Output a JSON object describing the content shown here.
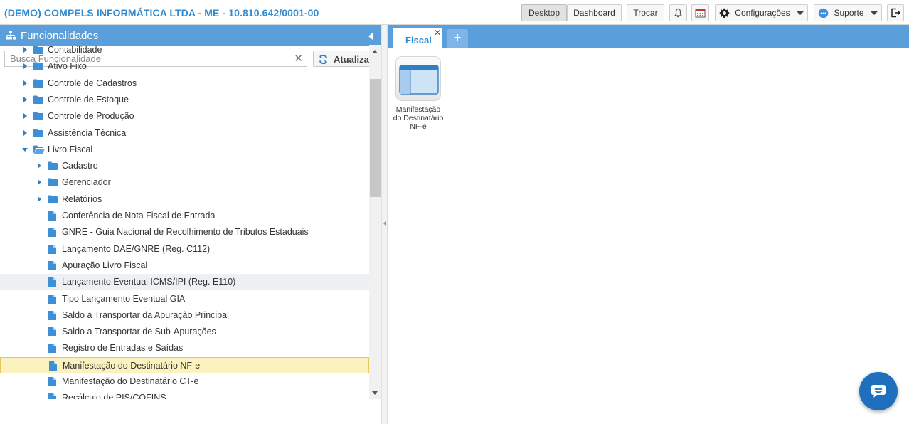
{
  "header": {
    "company": "(DEMO) COMPELS INFORMÁTICA LTDA - ME - 10.810.642/0001-00",
    "buttons": {
      "desktop": "Desktop",
      "dashboard": "Dashboard",
      "trocar": "Trocar",
      "configuracoes": "Configurações",
      "suporte": "Suporte"
    },
    "active_view": "Desktop",
    "icons": [
      "bell-icon",
      "calendar-icon",
      "gear-icon",
      "support-icon",
      "logout-icon"
    ]
  },
  "sidebar": {
    "title": "Funcionalidades",
    "search_placeholder": "Busca Funcionalidade",
    "search_value": "",
    "refresh_label": "Atualizar",
    "tree": [
      {
        "label": "Contabilidade",
        "type": "folder",
        "expanded": false,
        "level": 0
      },
      {
        "label": "Ativo Fixo",
        "type": "folder",
        "expanded": false,
        "level": 0
      },
      {
        "label": "Controle de Cadastros",
        "type": "folder",
        "expanded": false,
        "level": 0
      },
      {
        "label": "Controle de Estoque",
        "type": "folder",
        "expanded": false,
        "level": 0
      },
      {
        "label": "Controle de Produção",
        "type": "folder",
        "expanded": false,
        "level": 0
      },
      {
        "label": "Assistência Técnica",
        "type": "folder",
        "expanded": false,
        "level": 0
      },
      {
        "label": "Livro Fiscal",
        "type": "folder",
        "expanded": true,
        "level": 0
      },
      {
        "label": "Cadastro",
        "type": "folder",
        "expanded": false,
        "level": 1
      },
      {
        "label": "Gerenciador",
        "type": "folder",
        "expanded": false,
        "level": 1
      },
      {
        "label": "Relatórios",
        "type": "folder",
        "expanded": false,
        "level": 1
      },
      {
        "label": "Conferência de Nota Fiscal de Entrada",
        "type": "file",
        "level": 1
      },
      {
        "label": "GNRE - Guia Nacional de Recolhimento de Tributos Estaduais",
        "type": "file",
        "level": 1
      },
      {
        "label": "Lançamento DAE/GNRE (Reg. C112)",
        "type": "file",
        "level": 1
      },
      {
        "label": "Apuração Livro Fiscal",
        "type": "file",
        "level": 1
      },
      {
        "label": "Lançamento Eventual ICMS/IPI (Reg. E110)",
        "type": "file",
        "level": 1,
        "state": "hover"
      },
      {
        "label": "Tipo Lançamento Eventual GIA",
        "type": "file",
        "level": 1
      },
      {
        "label": "Saldo a Transportar da Apuração Principal",
        "type": "file",
        "level": 1
      },
      {
        "label": "Saldo a Transportar de Sub-Apurações",
        "type": "file",
        "level": 1
      },
      {
        "label": "Registro de Entradas e Saídas",
        "type": "file",
        "level": 1
      },
      {
        "label": "Manifestação do Destinatário NF-e",
        "type": "file",
        "level": 1,
        "state": "selected"
      },
      {
        "label": "Manifestação do Destinatário CT-e",
        "type": "file",
        "level": 1
      },
      {
        "label": "Recálculo de PIS/COFINS",
        "type": "file",
        "level": 1
      }
    ]
  },
  "workspace": {
    "tabs": [
      {
        "label": "Fiscal",
        "active": true
      }
    ],
    "desktop_icons": [
      {
        "label": "Manifestação do Destinatário NF-e",
        "icon": "window-app-icon"
      }
    ]
  },
  "chat": {
    "icon": "chat-icon"
  },
  "colors": {
    "accent": "#5a9fdc",
    "company_text": "#2f8bd0",
    "folder": "#3d8fd6",
    "selected_bg": "#fbf2bf",
    "hover_bg": "#eef1f4",
    "chat": "#1f6fbf"
  }
}
